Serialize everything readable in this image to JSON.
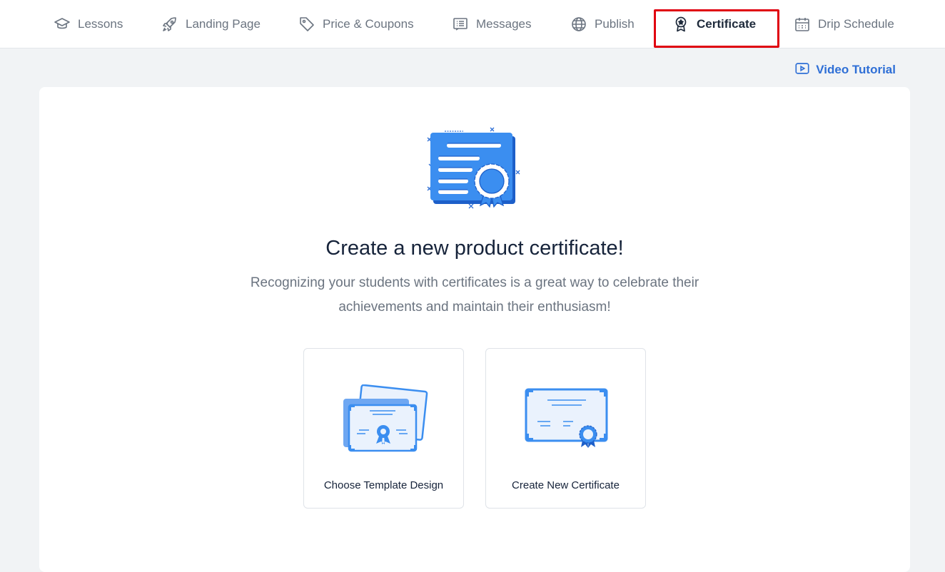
{
  "tabs": [
    {
      "label": "Lessons",
      "icon": "graduation-cap-icon",
      "active": false
    },
    {
      "label": "Landing Page",
      "icon": "rocket-icon",
      "active": false
    },
    {
      "label": "Price & Coupons",
      "icon": "tag-icon",
      "active": false
    },
    {
      "label": "Messages",
      "icon": "message-list-icon",
      "active": false
    },
    {
      "label": "Publish",
      "icon": "globe-icon",
      "active": false
    },
    {
      "label": "Certificate",
      "icon": "award-badge-icon",
      "active": true
    },
    {
      "label": "Drip Schedule",
      "icon": "calendar-icon",
      "active": false
    }
  ],
  "video_tutorial": {
    "label": "Video Tutorial",
    "icon": "play-video-icon"
  },
  "main": {
    "headline": "Create a new product certificate!",
    "subtext": "Recognizing your students with certificates is a great way to celebrate their achievements and maintain their enthusiasm!",
    "options": [
      {
        "label": "Choose Template Design",
        "icon": "certificate-templates-icon"
      },
      {
        "label": "Create New Certificate",
        "icon": "new-certificate-icon"
      }
    ]
  },
  "colors": {
    "accent": "#2f6fd6",
    "illustration_blue": "#3b8ef0",
    "highlight_border": "#e0000f",
    "text_dark": "#16233a",
    "text_muted": "#6b7480",
    "background": "#f1f3f5"
  }
}
